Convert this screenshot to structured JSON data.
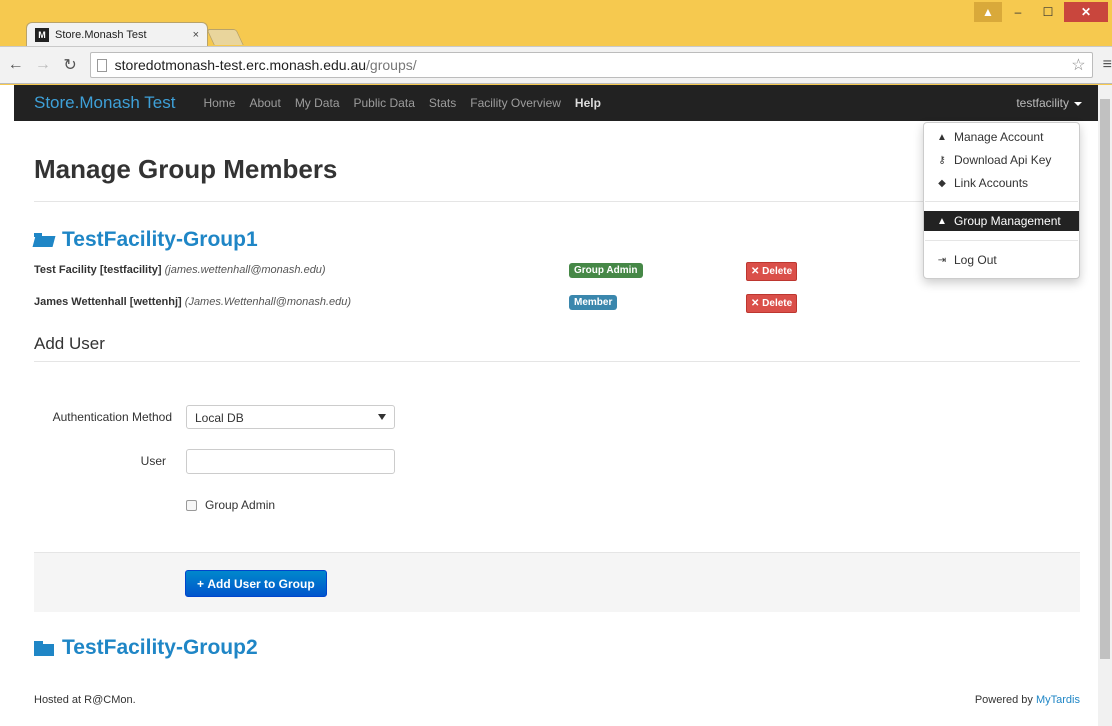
{
  "browser": {
    "tab_title": "Store.Monash Test",
    "tab_close": "×",
    "favicon_text": "M",
    "url_host": "storedotmonash-test.erc.monash.edu.au",
    "url_path": "/groups/"
  },
  "navbar": {
    "brand": "Store.Monash Test",
    "links": [
      "Home",
      "About",
      "My Data",
      "Public Data",
      "Stats",
      "Facility Overview",
      "Help"
    ],
    "user": "testfacility"
  },
  "dropdown": {
    "items": [
      "Manage Account",
      "Download Api Key",
      "Link Accounts",
      "Group Management",
      "Log Out"
    ],
    "active": "Group Management"
  },
  "page": {
    "title": "Manage Group Members",
    "groups": [
      {
        "name": "TestFacility-Group1",
        "members": [
          {
            "name": "Test Facility [testfacility]",
            "email": "(james.wettenhall@monash.edu)",
            "role": "Group Admin",
            "delete_label": "Delete"
          },
          {
            "name": "James Wettenhall [wettenhj]",
            "email": "(James.Wettenhall@monash.edu)",
            "role": "Member",
            "delete_label": "Delete"
          }
        ]
      },
      {
        "name": "TestFacility-Group2"
      }
    ],
    "add_user": {
      "heading": "Add User",
      "auth_label": "Authentication Method",
      "auth_value": "Local DB",
      "user_label": "User",
      "user_value": "",
      "admin_checkbox_label": "Group Admin",
      "submit_label": "Add User to Group"
    }
  },
  "footer": {
    "left": "Hosted at R@CMon.",
    "right_prefix": "Powered by",
    "right_link": "MyTardis"
  },
  "colors": {
    "accent": "#1f86c6",
    "navbar": "#222222",
    "admin_badge": "#468847",
    "member_badge": "#3a87ad",
    "delete": "#da4f49",
    "primary_button": "#0074cc"
  }
}
